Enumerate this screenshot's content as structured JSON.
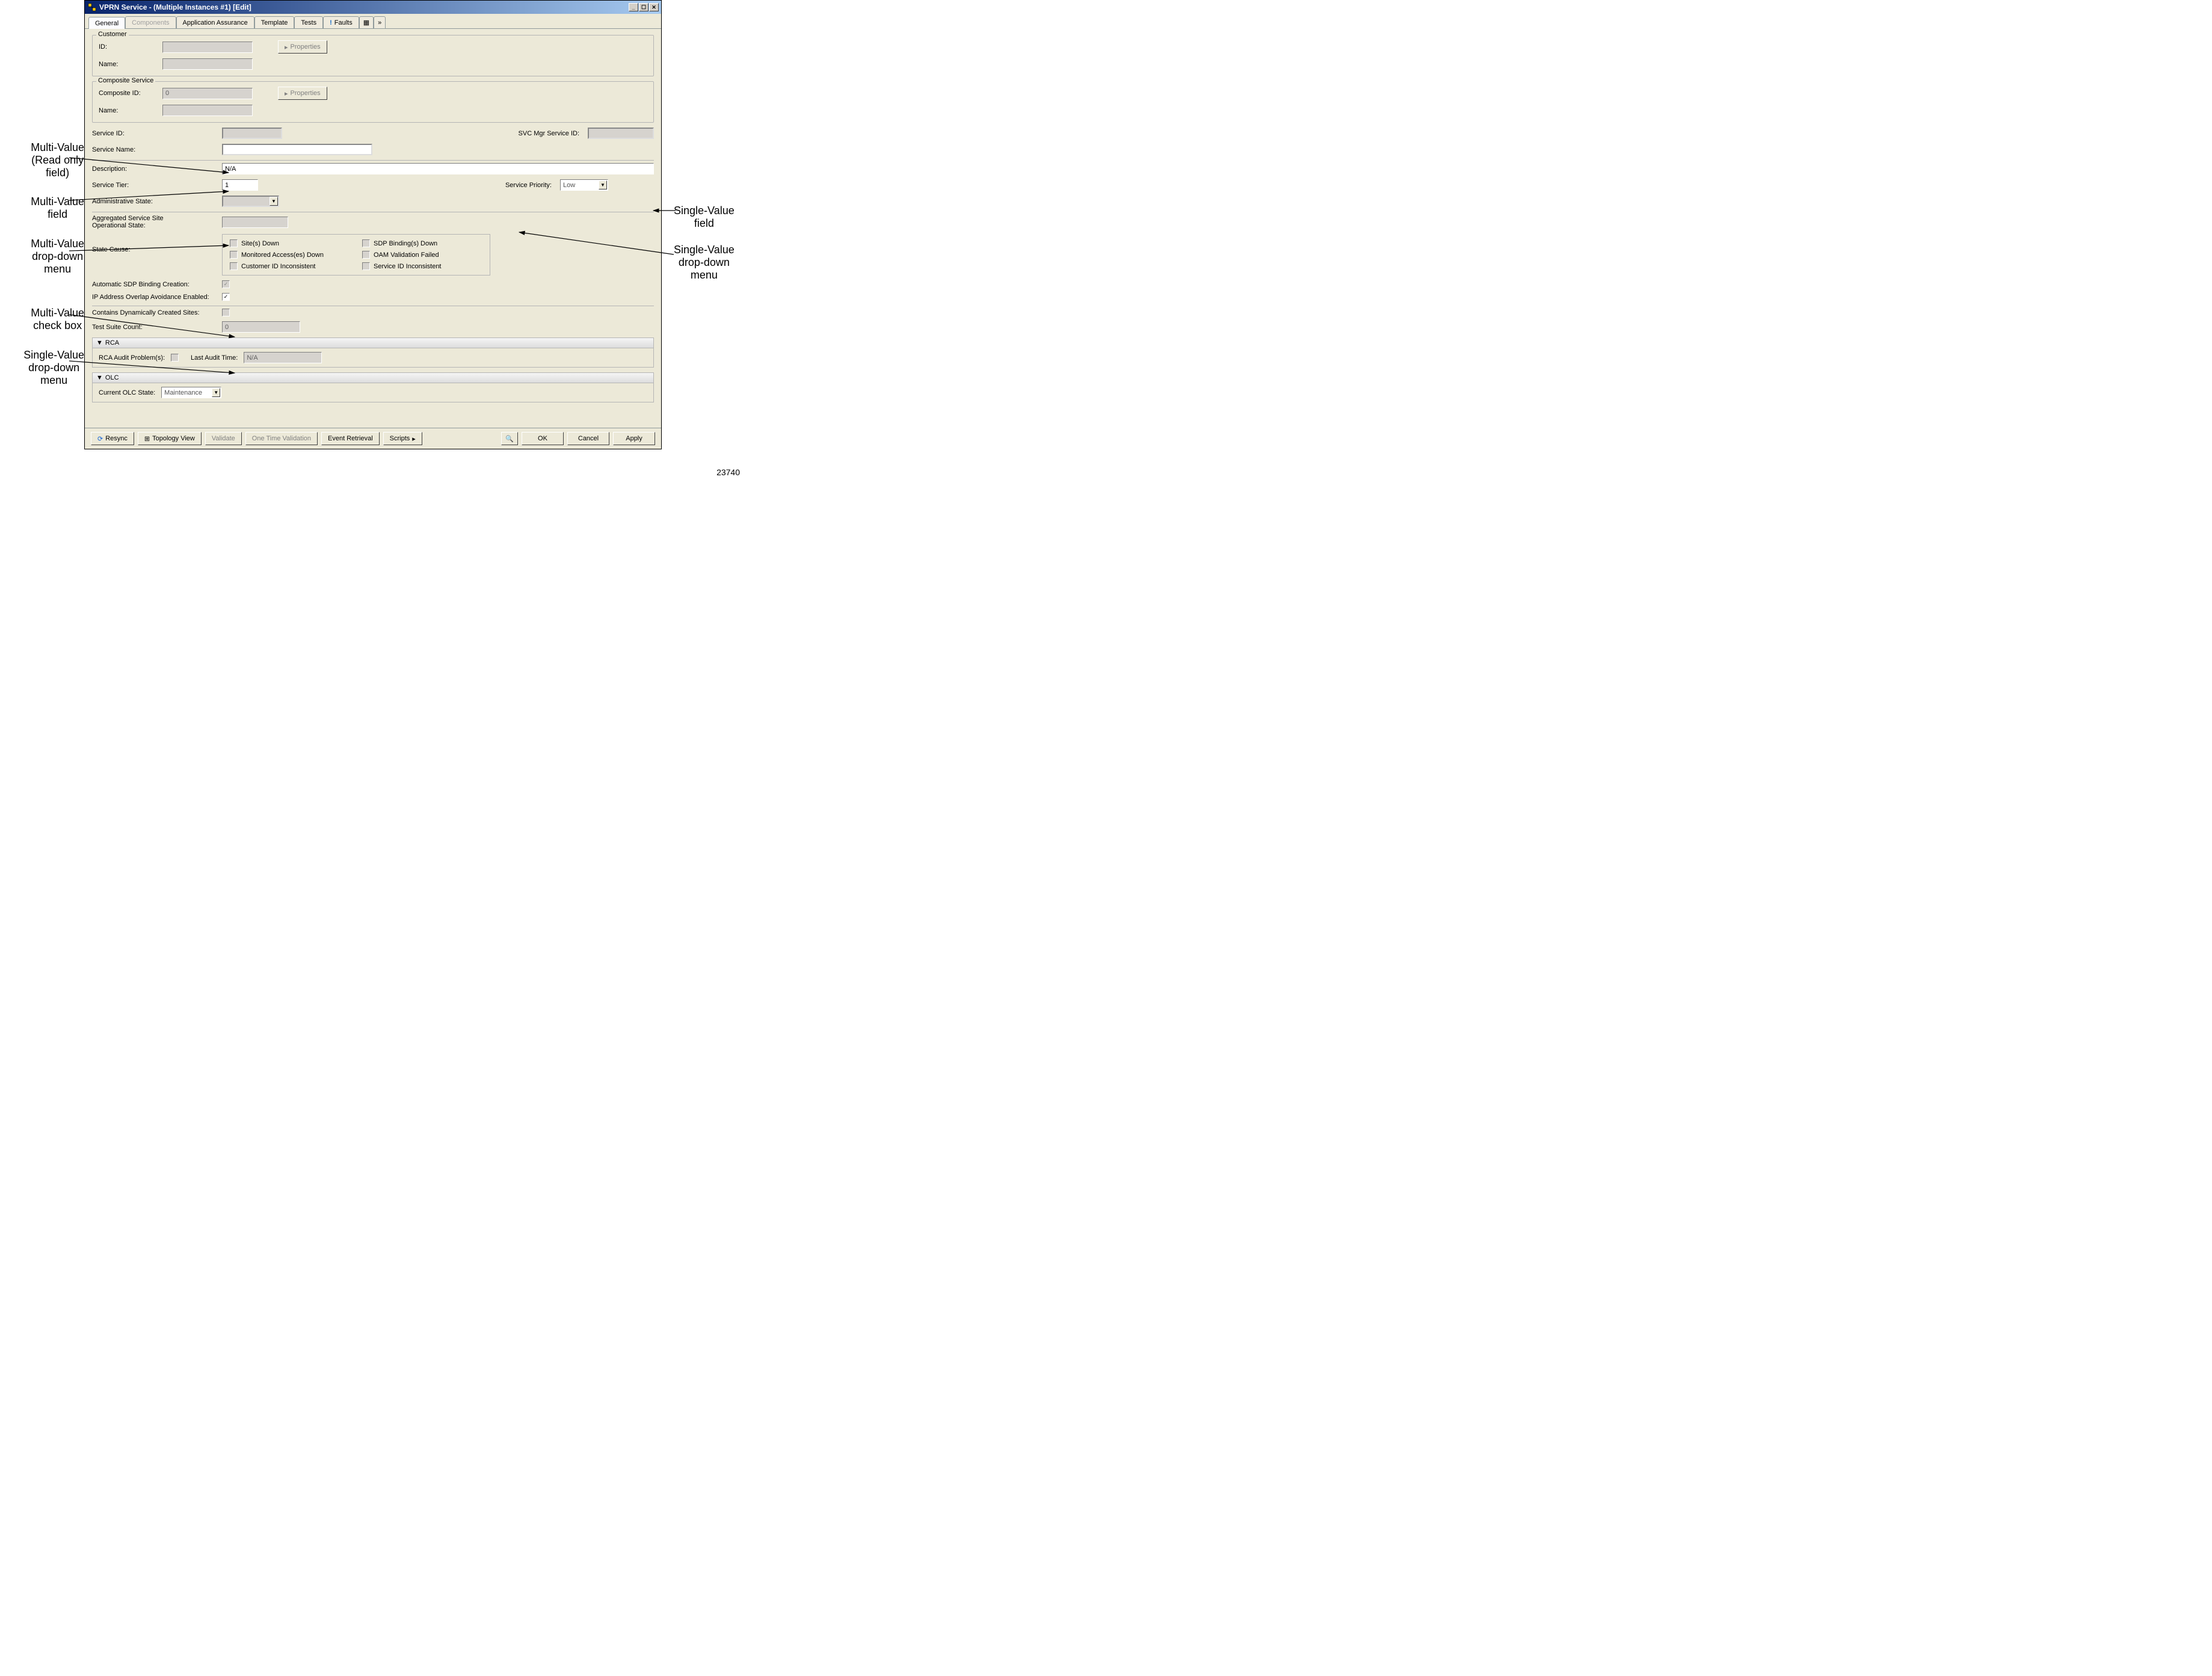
{
  "window": {
    "title": "VPRN Service - (Multiple Instances #1) [Edit]"
  },
  "tabs": {
    "general": "General",
    "components": "Components",
    "application_assurance": "Application Assurance",
    "template": "Template",
    "tests": "Tests",
    "faults": "Faults"
  },
  "customer": {
    "legend": "Customer",
    "id_label": "ID:",
    "id": "",
    "name_label": "Name:",
    "name": "",
    "properties_btn": "Properties"
  },
  "composite": {
    "legend": "Composite Service",
    "id_label": "Composite ID:",
    "id": "0",
    "name_label": "Name:",
    "name": "",
    "properties_btn": "Properties"
  },
  "fields": {
    "service_id_label": "Service ID:",
    "service_id": "",
    "svc_mgr_id_label": "SVC Mgr Service ID:",
    "svc_mgr_id": "",
    "service_name_label": "Service Name:",
    "service_name": "",
    "description_label": "Description:",
    "description": "N/A",
    "service_tier_label": "Service Tier:",
    "service_tier": "1",
    "service_priority_label": "Service Priority:",
    "service_priority": "Low",
    "admin_state_label": "Administrative State:",
    "admin_state": "",
    "agg_state_label": "Aggregated Service Site\nOperational State:",
    "agg_state": "",
    "state_cause_label": "State Cause:",
    "auto_sdp_label": "Automatic SDP Binding Creation:",
    "ip_overlap_label": "IP Address Overlap Avoidance Enabled:",
    "contains_dyn_label": "Contains Dynamically Created Sites:",
    "test_suite_label": "Test Suite Count:",
    "test_suite": "0"
  },
  "state_cause": {
    "sites_down": "Site(s) Down",
    "sdp_down": "SDP Binding(s) Down",
    "monitored_down": "Monitored Access(es) Down",
    "oam_failed": "OAM Validation Failed",
    "cust_inconsistent": "Customer ID Inconsistent",
    "svc_inconsistent": "Service ID Inconsistent"
  },
  "rca": {
    "header": "RCA",
    "audit_label": "RCA Audit Problem(s):",
    "last_audit_label": "Last Audit Time:",
    "last_audit": "N/A"
  },
  "olc": {
    "header": "OLC",
    "state_label": "Current OLC State:",
    "state": "Maintenance"
  },
  "buttons": {
    "resync": "Resync",
    "topology": "Topology View",
    "validate": "Validate",
    "one_time": "One Time Validation",
    "event_retrieval": "Event Retrieval",
    "scripts": "Scripts",
    "ok": "OK",
    "cancel": "Cancel",
    "apply": "Apply"
  },
  "annotations": {
    "multi_readonly": "Multi-Value\n(Read only\nfield)",
    "multi_field": "Multi-Value\nfield",
    "multi_dropdown": "Multi-Value\ndrop-down\nmenu",
    "multi_checkbox": "Multi-Value\ncheck box",
    "single_dropdown_left": "Single-Value\ndrop-down\nmenu",
    "single_field": "Single-Value\nfield",
    "single_dropdown_right": "Single-Value\ndrop-down\nmenu"
  },
  "footer_id": "23740"
}
